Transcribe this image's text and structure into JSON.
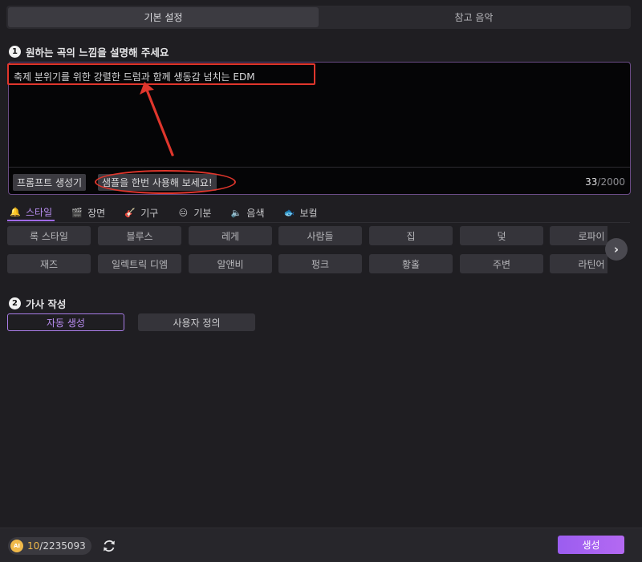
{
  "top_tabs": [
    {
      "label": "기본 설정"
    },
    {
      "label": "참고 음악"
    }
  ],
  "section1": {
    "number": "1",
    "title": "원하는 곡의 느낌을 설명해 주세요"
  },
  "prompt": {
    "text": "축제 분위기를 위한 강렬한 드럼과 함께 생동감 넘치는 EDM",
    "generator_label": "프롬프트 생성기",
    "sample_label": "샘플을 한번 사용해 보세요!",
    "count_current": "33",
    "count_max": "/2000"
  },
  "category_tabs": [
    {
      "label": "스타일",
      "icon": "bell-icon",
      "glyph": "🔔"
    },
    {
      "label": "장면",
      "icon": "clapper-icon",
      "glyph": "🎬"
    },
    {
      "label": "기구",
      "icon": "guitar-icon",
      "glyph": "🎸"
    },
    {
      "label": "기분",
      "icon": "smiley-icon",
      "glyph": "😐"
    },
    {
      "label": "음색",
      "icon": "speaker-icon",
      "glyph": "🔈"
    },
    {
      "label": "보컬",
      "icon": "fish-icon",
      "glyph": "🐟"
    }
  ],
  "styles_row1": [
    "록 스타일",
    "블루스",
    "레게",
    "사람들",
    "집",
    "덫",
    "로파이"
  ],
  "styles_row2": [
    "재즈",
    "일렉트릭 디엠",
    "알앤비",
    "펑크",
    "황홀",
    "주변",
    "라틴어"
  ],
  "section2": {
    "number": "2",
    "title": "가사 작성",
    "auto_label": "자동 생성",
    "custom_label": "사용자 정의"
  },
  "bottom": {
    "coin_label": "AI",
    "credits_used": "10",
    "credits_total": "/2235093",
    "generate_label": "생성"
  },
  "colors": {
    "accent": "#a97de8",
    "annotation": "#e0362c",
    "coin": "#f0b94a"
  }
}
